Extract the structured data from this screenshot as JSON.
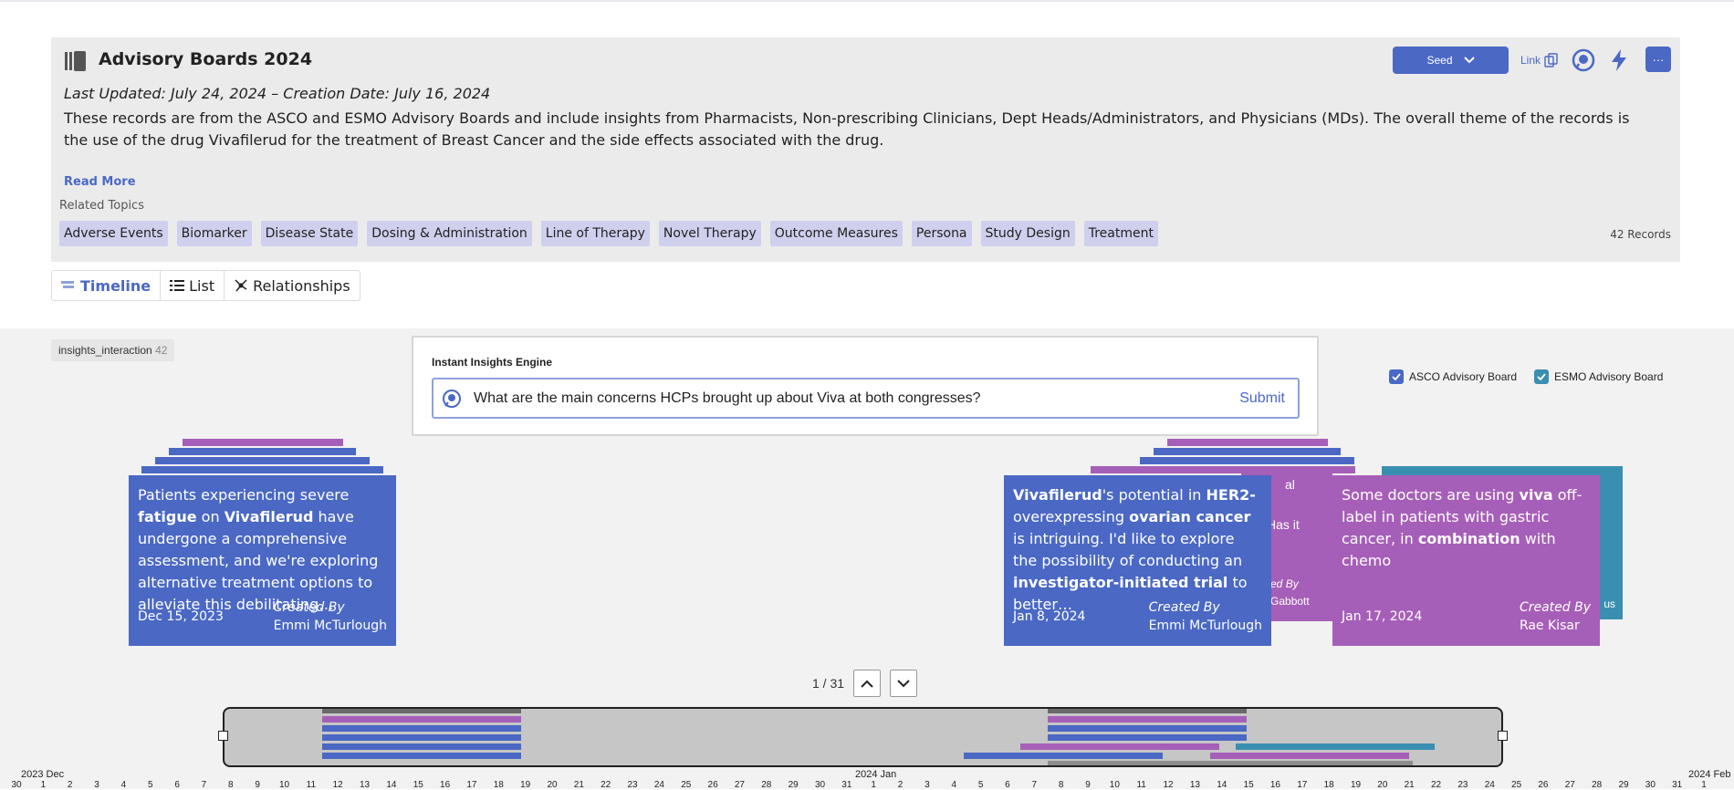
{
  "header": {
    "title": "Advisory Boards 2024",
    "dates": "Last Updated: July 24, 2024 – Creation Date: July 16, 2024",
    "description": "These records are from the ASCO and ESMO Advisory Boards and include insights from Pharmacists, Non-prescribing Clinicians, Dept Heads/Administrators, and Physicians (MDs). The overall theme of the records is the use of the drug Vivafilerud for the treatment of Breast Cancer and the side effects associated with the drug.",
    "read_more": "Read More",
    "related_label": "Related Topics",
    "topics": [
      "Adverse Events",
      "Biomarker",
      "Disease State",
      "Dosing & Administration",
      "Line of Therapy",
      "Novel Therapy",
      "Outcome Measures",
      "Persona",
      "Study Design",
      "Treatment"
    ],
    "records": "42 Records",
    "seed_label": "Seed",
    "link_label": "Link",
    "more_label": "···"
  },
  "tabs": [
    {
      "label": "Timeline",
      "icon": "timeline-icon",
      "active": true
    },
    {
      "label": "List",
      "icon": "list-icon",
      "active": false
    },
    {
      "label": "Relationships",
      "icon": "network-icon",
      "active": false
    }
  ],
  "collection": {
    "name": "insights_interaction",
    "count": "42"
  },
  "engine": {
    "label": "Instant Insights Engine",
    "query": "What are the main concerns HCPs brought up about Viva at both congresses?",
    "submit": "Submit"
  },
  "legend": [
    {
      "label": "ASCO Advisory Board",
      "color": "#4a68c4",
      "checked": true
    },
    {
      "label": "ESMO Advisory Board",
      "color": "#3a8fb0",
      "checked": true
    }
  ],
  "cards": {
    "card1": {
      "text_html": "Patients experiencing severe <b>fatigue</b> on <b>Vivafilerud</b> have undergone a comprehensive assessment, and we're exploring alternative treatment options to alleviate this debilitating…",
      "date": "Dec 15, 2023",
      "created_by_label": "Created By",
      "creator": "Emmi McTurlough"
    },
    "card2": {
      "text_html": "<b>Vivafilerud</b>'s potential in <b>HER2-</b> overexpressing <b>ovarian cancer</b> is intriguing. I'd like to explore the possibility of conducting an <b>investigator-initiated trial</b> to better…",
      "date": "Jan 8, 2024",
      "created_by_label": "Created By",
      "creator": "Emmi McTurlough"
    },
    "card3": {
      "text_html": "Some doctors are using <b>viva</b> off-label in patients with gastric cancer, in <b>combination</b> with chemo",
      "date": "Jan 17, 2024",
      "created_by_label": "Created By",
      "creator": "Rae Kisar"
    },
    "behind": {
      "frag1": "al",
      "frag2": "Has it",
      "frag3": "ated By",
      "frag4": "n Gabbott",
      "frag5": "us"
    }
  },
  "pager": {
    "text": "1 / 31"
  },
  "axis": {
    "month_left": "2023 Dec",
    "month_mid": "2024 Jan",
    "month_right": "2024 Feb",
    "ticks": [
      "30",
      "1",
      "2",
      "3",
      "4",
      "5",
      "6",
      "7",
      "8",
      "9",
      "10",
      "11",
      "12",
      "13",
      "14",
      "15",
      "16",
      "17",
      "18",
      "19",
      "20",
      "21",
      "22",
      "23",
      "24",
      "25",
      "26",
      "27",
      "28",
      "29",
      "30",
      "31",
      "1",
      "2",
      "3",
      "4",
      "5",
      "6",
      "7",
      "8",
      "9",
      "10",
      "11",
      "12",
      "13",
      "14",
      "15",
      "16",
      "17",
      "18",
      "19",
      "20",
      "21",
      "22",
      "23",
      "24",
      "25",
      "26",
      "27",
      "28",
      "29",
      "30",
      "31",
      "1"
    ]
  },
  "colors": {
    "asco": "#4a68c4",
    "esmo": "#3a8fb0",
    "purple": "#a65fb8",
    "accent": "#4a68c4"
  }
}
